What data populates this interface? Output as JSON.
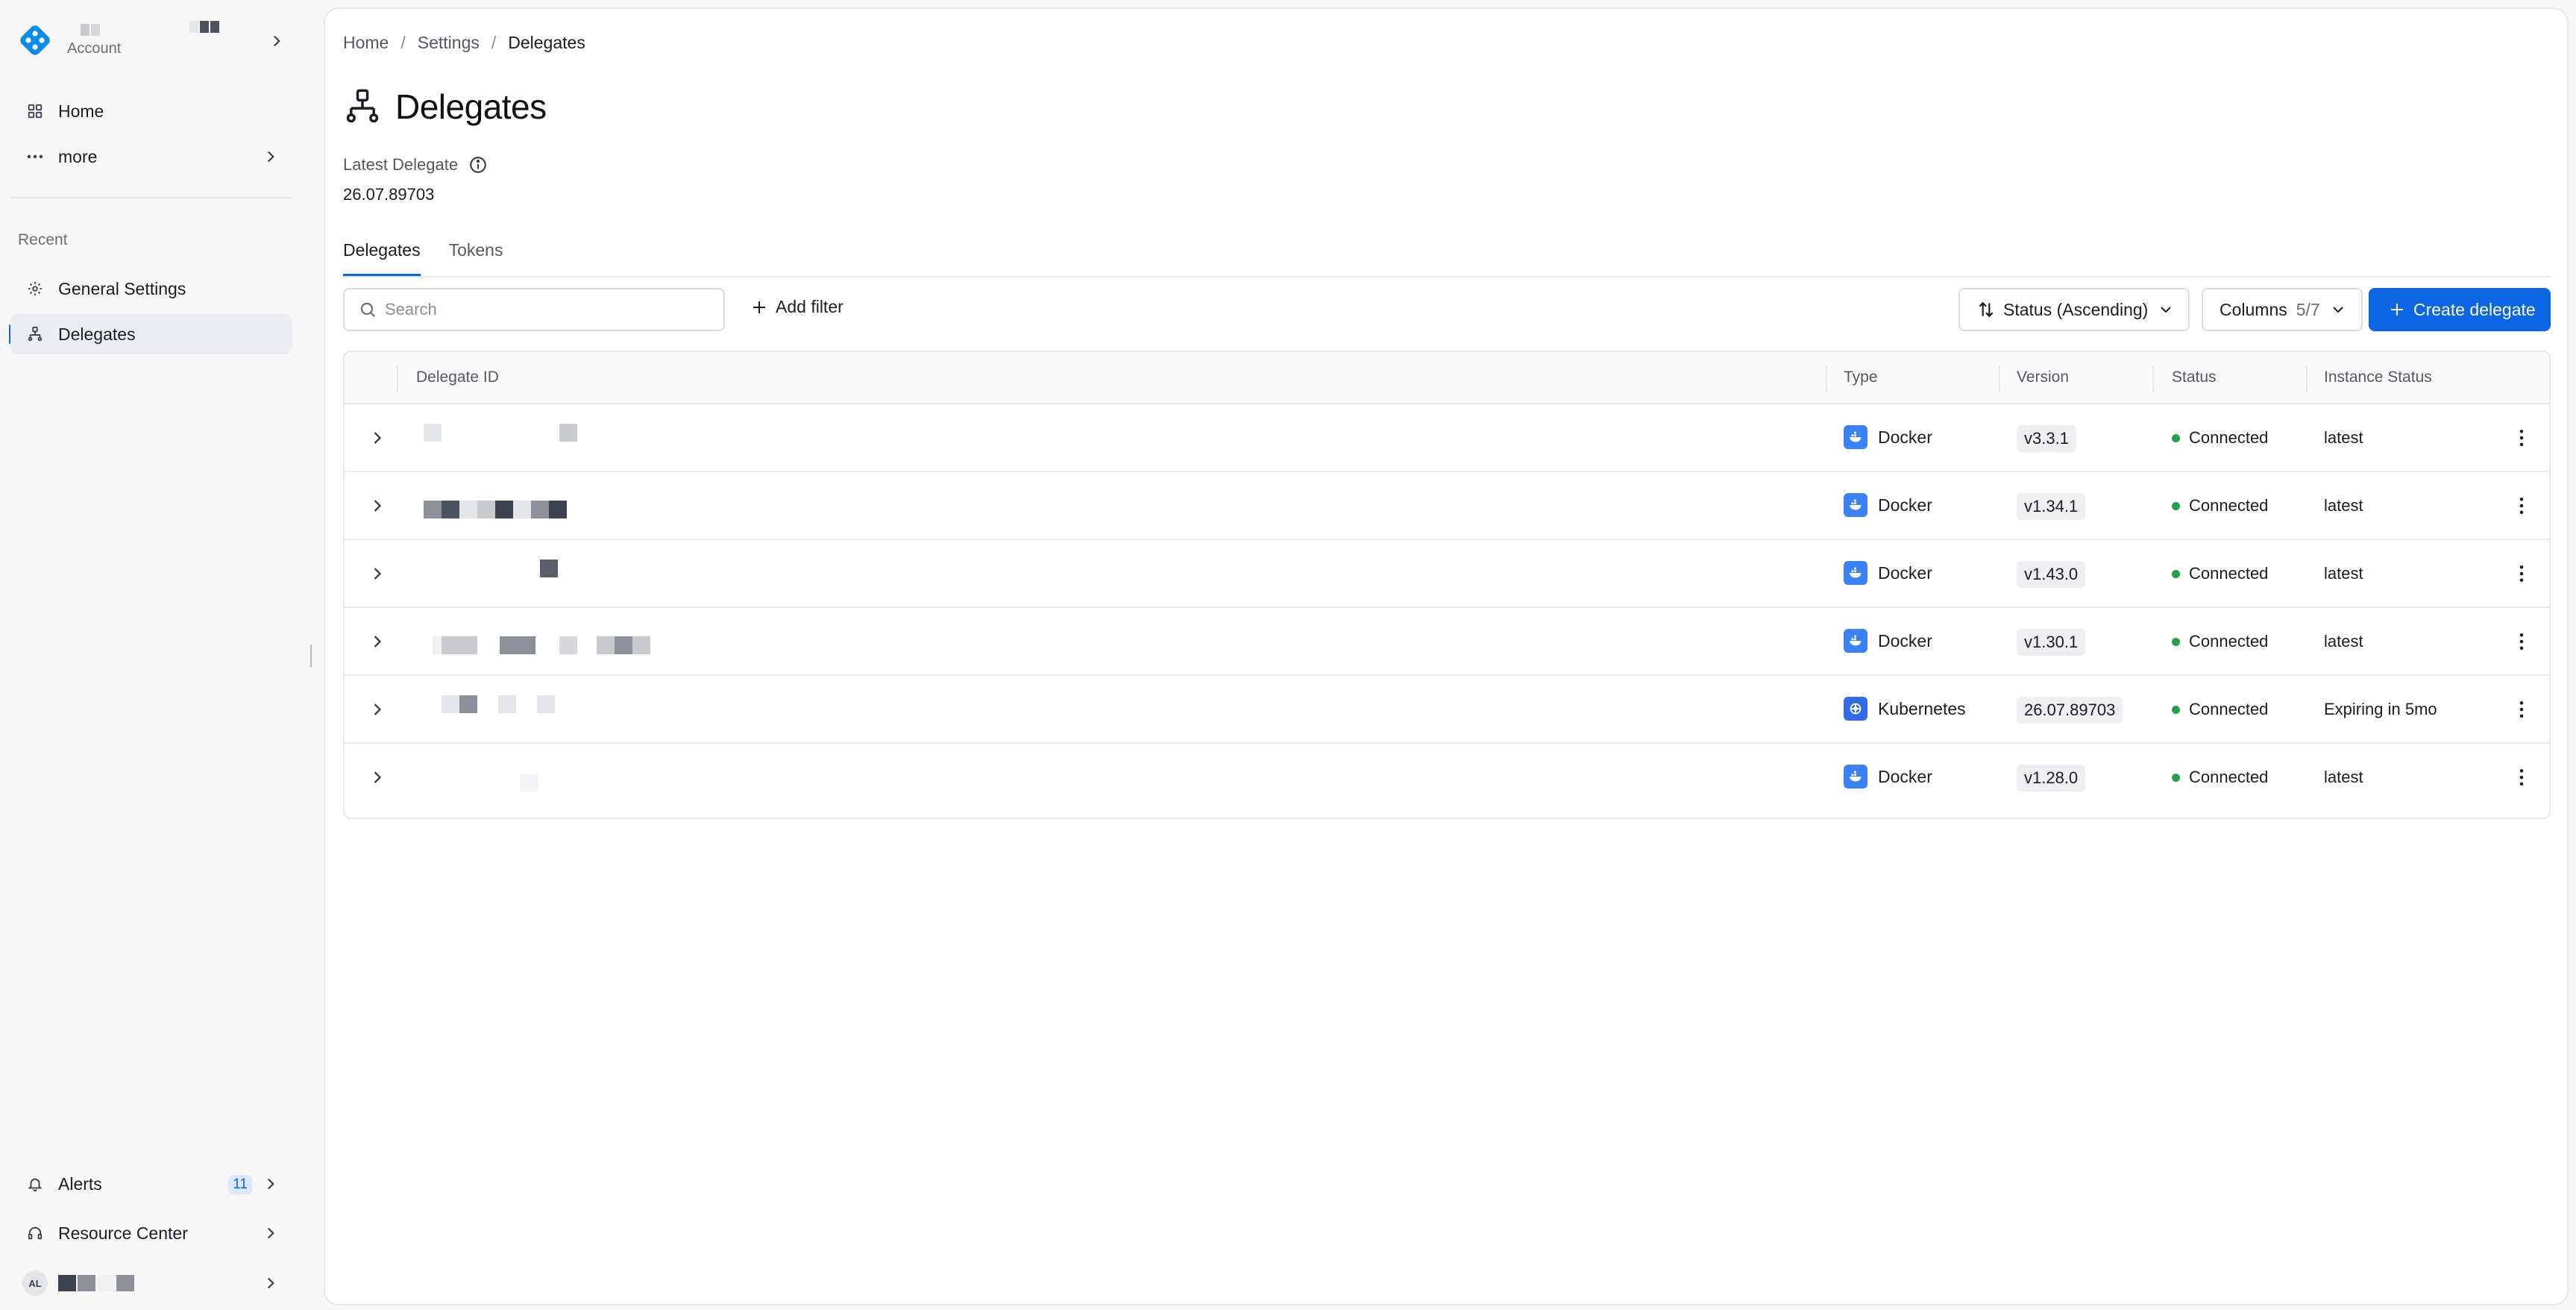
{
  "sidebar": {
    "account_label": "Account",
    "nav": {
      "home": "Home",
      "more": "more"
    },
    "recent_label": "Recent",
    "recent": {
      "general_settings": "General Settings",
      "delegates": "Delegates"
    },
    "bottom": {
      "alerts": "Alerts",
      "alerts_count": "11",
      "resource_center": "Resource Center",
      "user_initials": "AL"
    }
  },
  "breadcrumb": {
    "home": "Home",
    "settings": "Settings",
    "current": "Delegates",
    "separator": "/"
  },
  "page": {
    "title": "Delegates",
    "latest_label": "Latest Delegate",
    "latest_value": "26.07.89703"
  },
  "tabs": {
    "delegates": "Delegates",
    "tokens": "Tokens"
  },
  "toolbar": {
    "search_placeholder": "Search",
    "add_filter": "Add filter",
    "sort_label": "Status (Ascending)",
    "columns_label": "Columns",
    "columns_count": "5/7",
    "create_label": "Create delegate"
  },
  "table": {
    "headers": {
      "delegate_id": "Delegate ID",
      "type": "Type",
      "version": "Version",
      "status": "Status",
      "instance_status": "Instance Status"
    },
    "rows": [
      {
        "type": "Docker",
        "version": "v3.3.1",
        "status": "Connected",
        "instance_status": "latest"
      },
      {
        "type": "Docker",
        "version": "v1.34.1",
        "status": "Connected",
        "instance_status": "latest"
      },
      {
        "type": "Docker",
        "version": "v1.43.0",
        "status": "Connected",
        "instance_status": "latest"
      },
      {
        "type": "Docker",
        "version": "v1.30.1",
        "status": "Connected",
        "instance_status": "latest"
      },
      {
        "type": "Kubernetes",
        "version": "26.07.89703",
        "status": "Connected",
        "instance_status": "Expiring in 5mo"
      },
      {
        "type": "Docker",
        "version": "v1.28.0",
        "status": "Connected",
        "instance_status": "latest"
      }
    ]
  },
  "colors": {
    "accent": "#0c66e4",
    "status_connected": "#24a148",
    "docker_icon": "#3b82f6",
    "kubernetes_icon": "#326ce5"
  },
  "icons": {
    "logo": "brand-logo-icon",
    "home": "grid-icon",
    "more": "dots-icon",
    "settings": "gear-icon",
    "delegates": "network-icon",
    "alerts": "bell-icon",
    "resource_center": "headset-icon",
    "search": "search-icon",
    "add": "plus-icon",
    "sort": "sort-icon",
    "chevron": "chevron-icon",
    "info": "info-icon",
    "kebab": "kebab-icon",
    "docker": "docker-icon",
    "kubernetes": "kubernetes-icon"
  }
}
